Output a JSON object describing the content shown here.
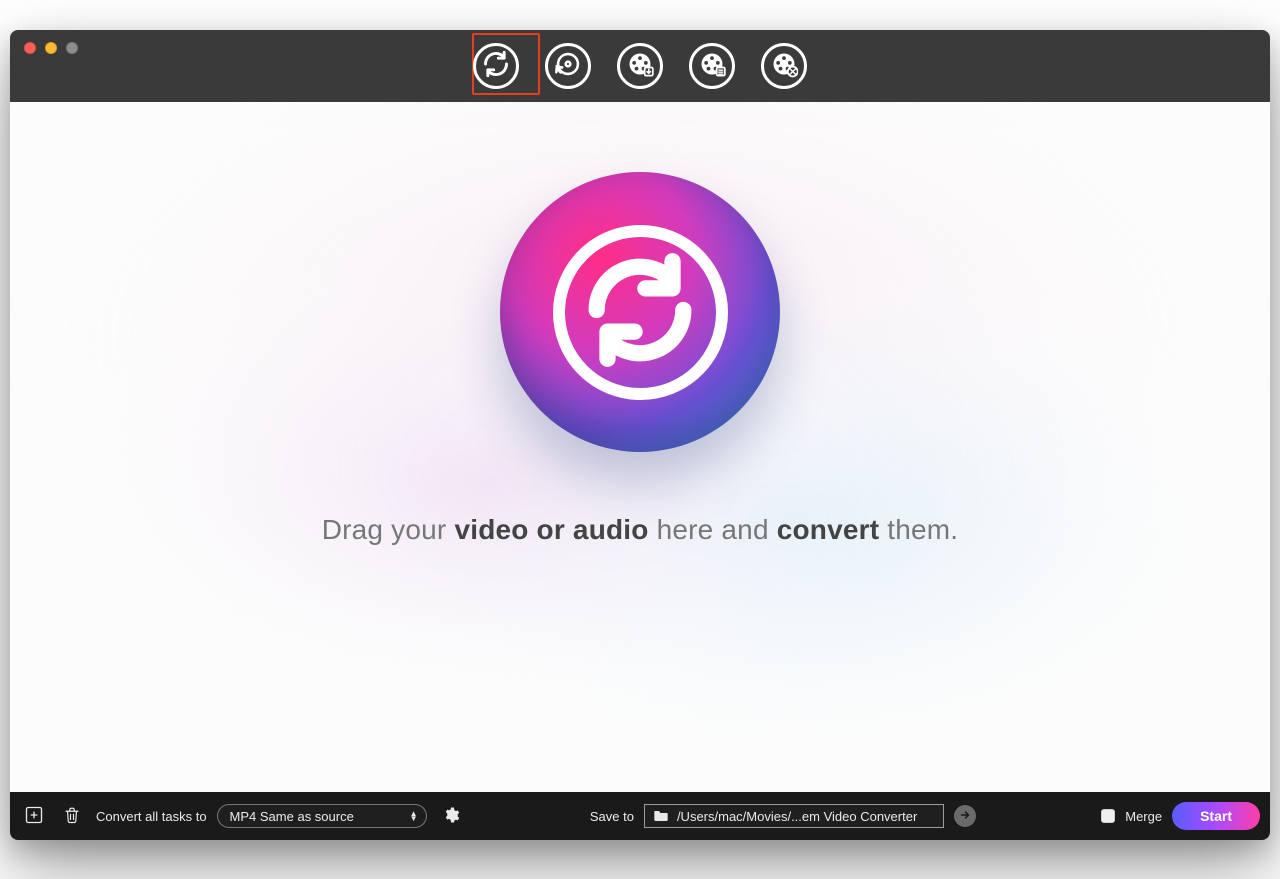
{
  "toolbar": {
    "tabs": [
      {
        "name": "convert-tab",
        "active": true
      },
      {
        "name": "rip-tab",
        "active": false
      },
      {
        "name": "download-tab",
        "active": false
      },
      {
        "name": "edit-tab",
        "active": false
      },
      {
        "name": "toolbox-tab",
        "active": false
      }
    ]
  },
  "dropzone": {
    "hint_parts": {
      "p1": "Drag your ",
      "b1": "video or audio",
      "p2": " here and ",
      "b2": "convert",
      "p3": " them."
    }
  },
  "footer": {
    "convert_label": "Convert all tasks to",
    "format_selected": "MP4 Same as source",
    "save_to_label": "Save to",
    "save_path": "/Users/mac/Movies/...em Video Converter",
    "merge_label": "Merge",
    "merge_checked": false,
    "start_label": "Start"
  },
  "colors": {
    "highlight": "#e73e1f",
    "accent_gradient": [
      "#5a5cff",
      "#a94bff",
      "#ff3ea6"
    ]
  }
}
